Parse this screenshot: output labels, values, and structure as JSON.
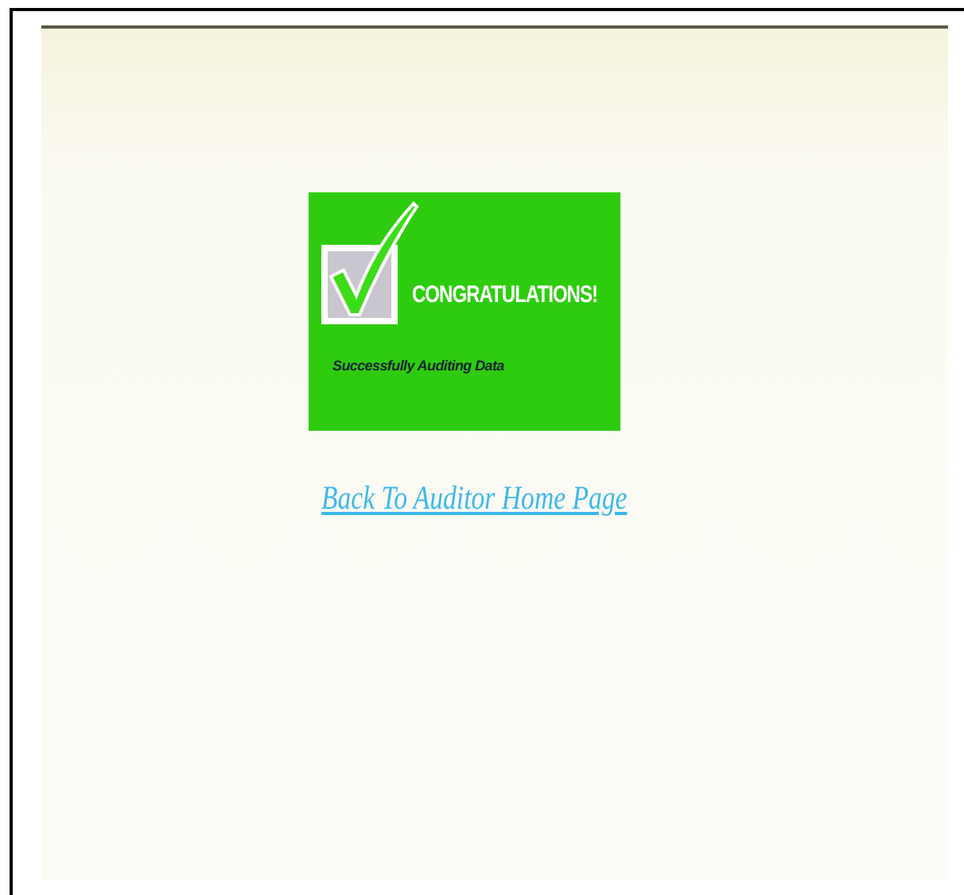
{
  "banner": {
    "title": "CONGRATULATIONS!",
    "message": "Successfully Auditing Data",
    "checked": true
  },
  "link": {
    "label": "Back To Auditor Home Page"
  }
}
